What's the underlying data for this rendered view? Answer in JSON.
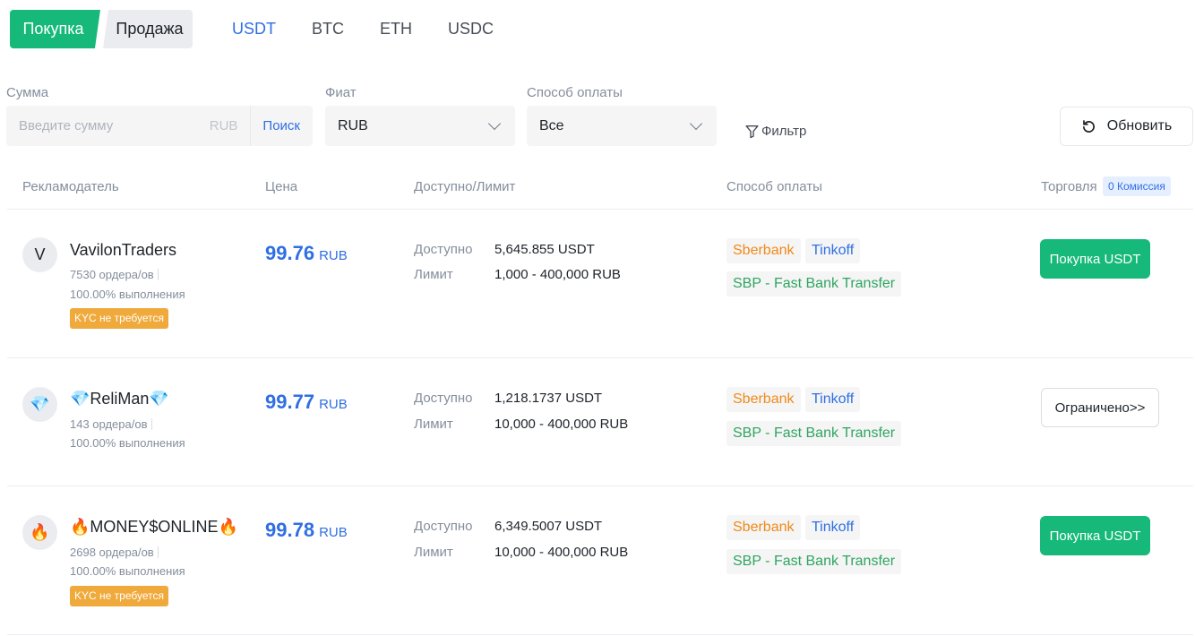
{
  "side_tabs": {
    "buy": "Покупка",
    "sell": "Продажа"
  },
  "coins": [
    "USDT",
    "BTC",
    "ETH",
    "USDC"
  ],
  "active_coin": "USDT",
  "filters": {
    "amount_label": "Сумма",
    "amount_placeholder": "Введите сумму",
    "amount_unit": "RUB",
    "search_label": "Поиск",
    "fiat_label": "Фиат",
    "fiat_value": "RUB",
    "payment_label": "Способ оплаты",
    "payment_value": "Все",
    "filter_label": "Фильтр",
    "refresh_label": "Обновить"
  },
  "table_header": {
    "advertiser": "Рекламодатель",
    "price": "Цена",
    "available_limit": "Доступно/Лимит",
    "payment": "Способ оплаты",
    "trade": "Торговля",
    "commission_badge": "0 Комиссия"
  },
  "labels": {
    "available": "Доступно",
    "limit": "Лимит"
  },
  "rows": [
    {
      "avatar": "V",
      "name": "VavilonTraders",
      "orders": "7530 ордера/ов",
      "completion": "100.00% выполнения",
      "kyc": "KYC не требуется",
      "price": "99.76",
      "currency": "RUB",
      "available": "5,645.855 USDT",
      "limit": "1,000 - 400,000 RUB",
      "payments": [
        "Sberbank",
        "Tinkoff",
        "SBP - Fast Bank Transfer"
      ],
      "action": "Покупка USDT"
    },
    {
      "avatar": "💎",
      "name": "💎ReliMan💎",
      "orders": "143 ордера/ов",
      "completion": "100.00% выполнения",
      "kyc": "",
      "price": "99.77",
      "currency": "RUB",
      "available": "1,218.1737 USDT",
      "limit": "10,000 - 400,000 RUB",
      "payments": [
        "Sberbank",
        "Tinkoff",
        "SBP - Fast Bank Transfer"
      ],
      "action": "Ограничено>>"
    },
    {
      "avatar": "🔥",
      "name": "🔥MONEY$ONLINE🔥",
      "orders": "2698 ордера/ов",
      "completion": "100.00% выполнения",
      "kyc": "KYC не требуется",
      "price": "99.78",
      "currency": "RUB",
      "available": "6,349.5007 USDT",
      "limit": "10,000 - 400,000 RUB",
      "payments": [
        "Sberbank",
        "Tinkoff",
        "SBP - Fast Bank Transfer"
      ],
      "action": "Покупка USDT"
    }
  ],
  "colors": {
    "accent_green": "#16b979",
    "accent_blue": "#2f6fe4",
    "kyc_orange": "#f0a93b",
    "sberbank": "#f0891a",
    "sbp": "#2fa561"
  },
  "icons": [
    "chevron-down-icon",
    "filter-icon",
    "refresh-icon"
  ]
}
